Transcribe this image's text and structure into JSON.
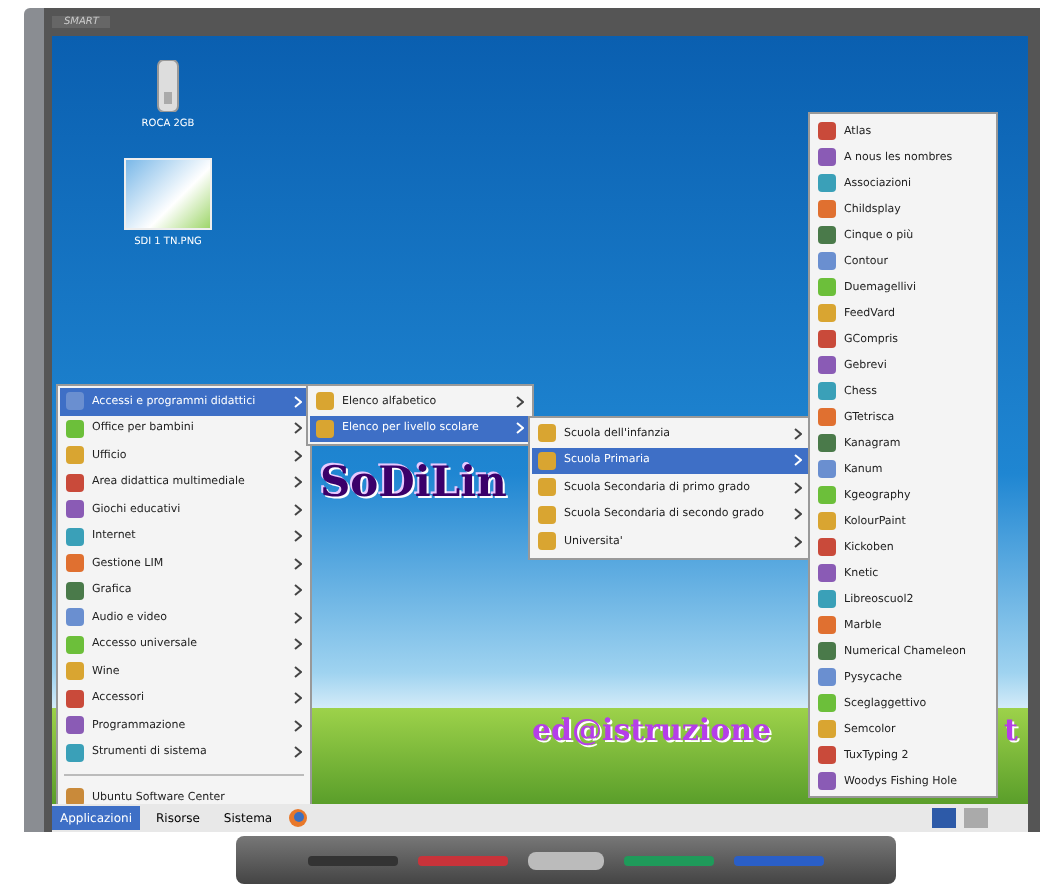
{
  "board": {
    "brand": "SMART"
  },
  "desktop_icons": [
    {
      "kind": "drive",
      "label": "ROCA 2GB"
    },
    {
      "kind": "screenshot",
      "label": "SDI 1 TN.PNG"
    }
  ],
  "overlay_texts": [
    {
      "kind": "title",
      "text": "SoDiLin"
    },
    {
      "kind": "email",
      "text": "ed@istruzione"
    },
    {
      "kind": "email_tail",
      "text": "t"
    }
  ],
  "main_menu": [
    {
      "label": "Accessi e programmi didattici",
      "selected": true,
      "submenu": true
    },
    {
      "label": "Office per bambini",
      "selected": false,
      "submenu": true
    },
    {
      "label": "Ufficio",
      "selected": false,
      "submenu": true
    },
    {
      "label": "Area didattica multimediale",
      "selected": false,
      "submenu": true
    },
    {
      "label": "Giochi educativi",
      "selected": false,
      "submenu": true
    },
    {
      "label": "Internet",
      "selected": false,
      "submenu": true
    },
    {
      "label": "Gestione LIM",
      "selected": false,
      "submenu": true
    },
    {
      "label": "Grafica",
      "selected": false,
      "submenu": true
    },
    {
      "label": "Audio e video",
      "selected": false,
      "submenu": true
    },
    {
      "label": "Accesso universale",
      "selected": false,
      "submenu": true
    },
    {
      "label": "Wine",
      "selected": false,
      "submenu": true
    },
    {
      "label": "Accessori",
      "selected": false,
      "submenu": true
    },
    {
      "label": "Programmazione",
      "selected": false,
      "submenu": true
    },
    {
      "label": "Strumenti di sistema",
      "selected": false,
      "submenu": true
    }
  ],
  "main_menu_footer": {
    "label": "Ubuntu Software Center"
  },
  "submenu_1": [
    {
      "label": "Elenco alfabetico",
      "selected": false
    },
    {
      "label": "Elenco per livello scolare",
      "selected": true
    }
  ],
  "submenu_2": [
    {
      "label": "Scuola dell'infanzia",
      "selected": false
    },
    {
      "label": "Scuola Primaria",
      "selected": true
    },
    {
      "label": "Scuola Secondaria di primo grado",
      "selected": false
    },
    {
      "label": "Scuola Secondaria di secondo grado",
      "selected": false
    },
    {
      "label": "Universita'",
      "selected": false
    }
  ],
  "apps": [
    "Atlas",
    "A nous les nombres",
    "Associazioni",
    "Childsplay",
    "Cinque o più",
    "Contour",
    "Duemagellivi",
    "FeedVard",
    "GCompris",
    "Gebrevi",
    "Chess",
    "GTetrisca",
    "Kanagram",
    "Kanum",
    "Kgeography",
    "KolourPaint",
    "Kickoben",
    "Knetic",
    "Libreoscuol2",
    "Marble",
    "Numerical Chameleon",
    "Pysycache",
    "Sceglaggettivo",
    "Semcolor",
    "TuxTyping 2",
    "Woodys Fishing Hole"
  ],
  "taskbar": {
    "menus": [
      "Applicazioni",
      "Risorse",
      "Sistema"
    ]
  }
}
